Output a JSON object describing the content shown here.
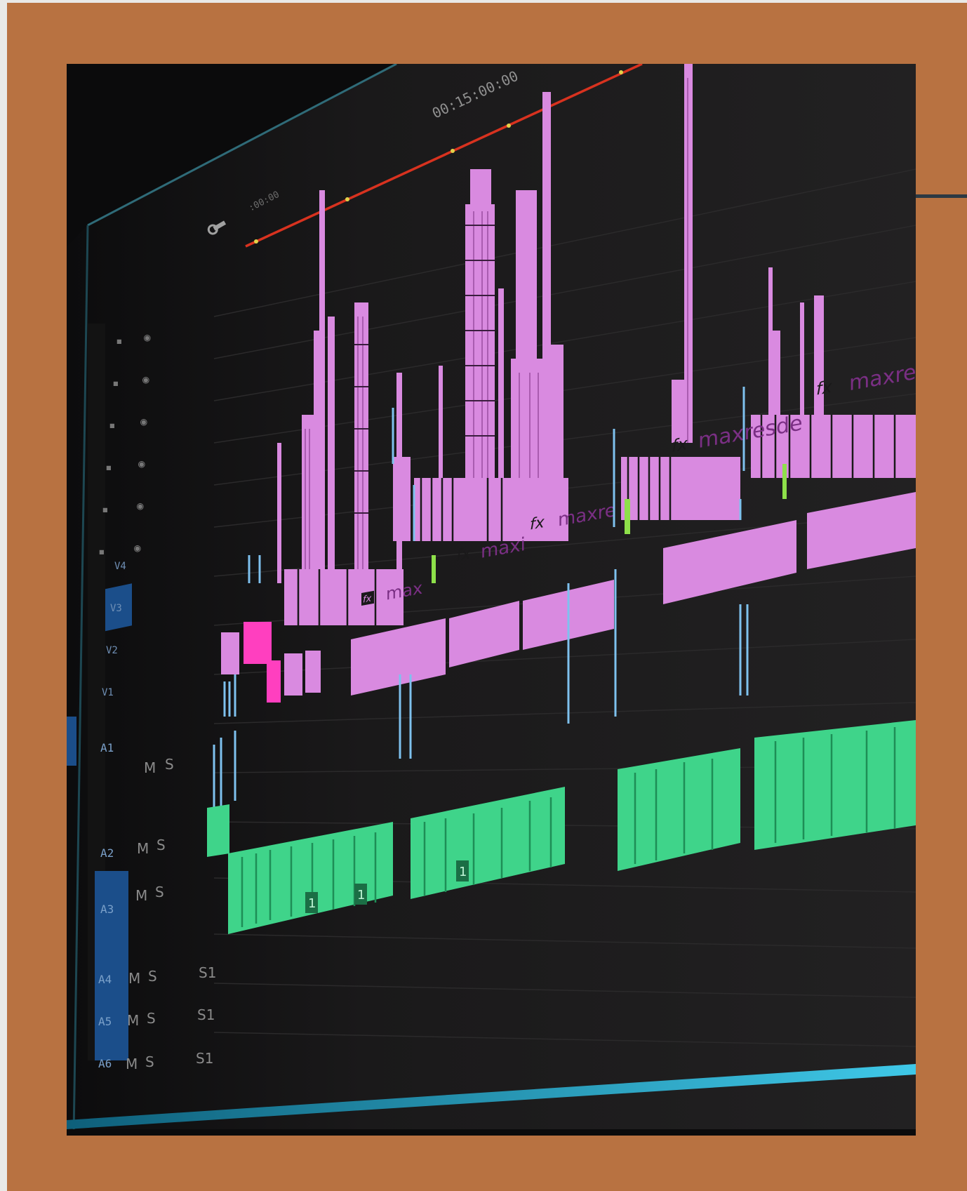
{
  "timeline": {
    "timecode_main": "00:15:00:00",
    "timecode_start": ":00:00"
  },
  "clips": {
    "fx_badge": "fx",
    "clip_1": "max",
    "clip_2": "maxi",
    "clip_3": "maxre",
    "clip_4": "maxresde",
    "clip_5": "maxre"
  },
  "audio_clip_markers": [
    "1",
    "1",
    "1"
  ],
  "tracks": {
    "video": [
      "V4",
      "V3",
      "V2",
      "V1"
    ],
    "audio": [
      "A1",
      "A2",
      "A3",
      "A4",
      "A5",
      "A6"
    ],
    "mute": "M",
    "solo": "S",
    "submix": "S1"
  },
  "colors": {
    "background": "#b87241",
    "frame": "#171617",
    "video_clip": "#d98ae0",
    "video_clip_dark": "#c45fd0",
    "magenta_clip": "#ff3fbf",
    "audio_clip": "#3fd48a",
    "audio_clip_dark": "#1e8e56",
    "playhead_line": "#d8321f",
    "selected_track": "#1b4e8a",
    "accent_bar": "#2c3943"
  }
}
